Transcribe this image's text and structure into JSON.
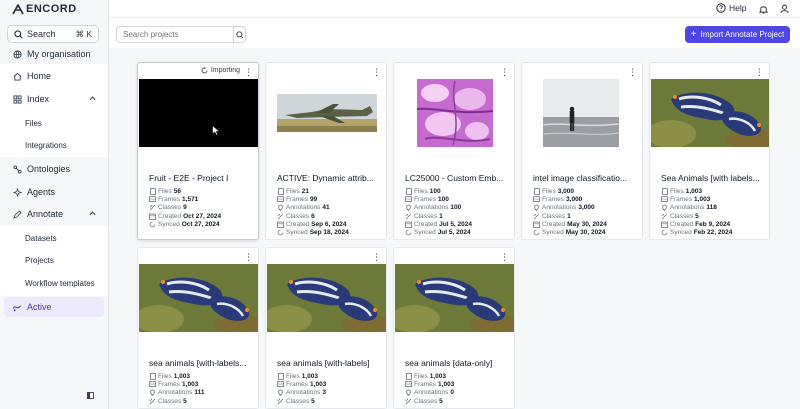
{
  "app": {
    "logo_text": "ENCORD"
  },
  "sidebar": {
    "search_label": "Search",
    "search_shortcut": "⌘ K",
    "items": [
      {
        "label": "My organisation",
        "icon": "globe-icon"
      },
      {
        "label": "Home",
        "icon": "home-icon"
      },
      {
        "label": "Index",
        "icon": "grid-icon"
      },
      {
        "label": "Files"
      },
      {
        "label": "Integrations"
      },
      {
        "label": "Ontologies",
        "icon": "ontology-icon"
      },
      {
        "label": "Agents",
        "icon": "agents-icon"
      },
      {
        "label": "Annotate",
        "icon": "annotate-icon"
      },
      {
        "label": "Datasets"
      },
      {
        "label": "Projects"
      },
      {
        "label": "Workflow templates"
      },
      {
        "label": "Active",
        "icon": "active-icon"
      }
    ]
  },
  "header": {
    "help_label": "Help"
  },
  "toolbar": {
    "search_placeholder": "Search projects",
    "import_label": "Import Annotate Project"
  },
  "colors": {
    "accent": "#4f46e5",
    "active_bg": "#ede9fe"
  },
  "labels": {
    "files": "Files",
    "frames": "Frames",
    "annotations": "Annotations",
    "classes": "Classes",
    "created": "Created",
    "synced": "Synced",
    "importing": "Importing"
  },
  "cards": [
    {
      "title": "Fruit - E2E - Project I",
      "files": "56",
      "frames": "1,571",
      "annotations": null,
      "classes": "9",
      "created": "Oct 27, 2024",
      "synced": "Oct 27, 2024",
      "status": "Importing",
      "thumb": "black"
    },
    {
      "title": "ACTIVE: Dynamic attrib...",
      "files": "21",
      "frames": "99",
      "annotations": "41",
      "classes": "6",
      "created": "Sep 6, 2024",
      "synced": "Sep 18, 2024",
      "thumb": "jet"
    },
    {
      "title": "LC25000 - Custom Emb...",
      "files": "100",
      "frames": "100",
      "annotations": "100",
      "classes": "1",
      "created": "Jul 5, 2024",
      "synced": "Jul 5, 2024",
      "thumb": "tissue"
    },
    {
      "title": "intel image classificatio...",
      "files": "3,000",
      "frames": "3,000",
      "annotations": "3,000",
      "classes": "1",
      "created": "May 30, 2024",
      "synced": "May 30, 2024",
      "thumb": "sea"
    },
    {
      "title": "Sea Animals [with labels...",
      "files": "1,003",
      "frames": "1,003",
      "annotations": "118",
      "classes": "5",
      "created": "Feb 9, 2024",
      "synced": "Feb 22, 2024",
      "thumb": "slug"
    },
    {
      "title": "sea animals [with-labels...",
      "files": "1,003",
      "frames": "1,003",
      "annotations": "111",
      "classes": "5",
      "thumb": "slug"
    },
    {
      "title": "sea animals [with-labels]",
      "files": "1,003",
      "frames": "1,003",
      "annotations": "3",
      "classes": "5",
      "thumb": "slug"
    },
    {
      "title": "sea animals [data-only]",
      "files": "1,003",
      "frames": "1,003",
      "annotations": "0",
      "classes": "5",
      "thumb": "slug"
    }
  ]
}
